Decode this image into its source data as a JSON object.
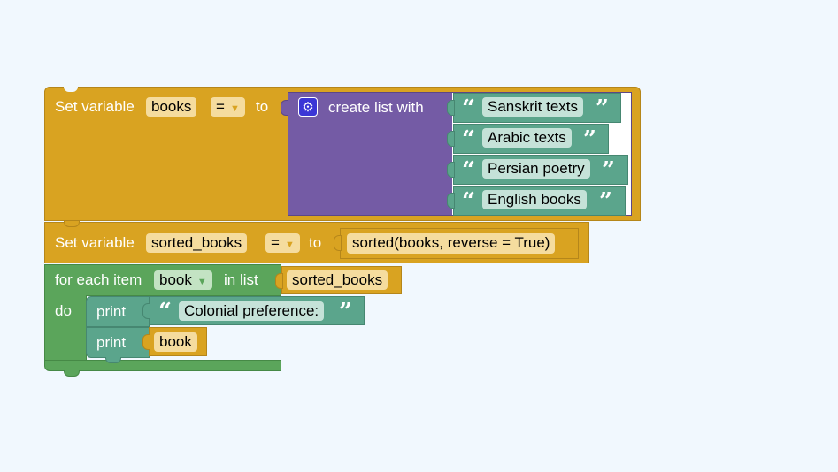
{
  "workspace": {
    "blocks": {
      "set_books": {
        "label_set": "Set variable",
        "variable": "books",
        "operator": "=",
        "label_to": "to"
      },
      "create_list": {
        "label": "create list with",
        "items": [
          "Sanskrit texts",
          "Arabic texts",
          "Persian poetry",
          "English books"
        ]
      },
      "set_sorted": {
        "label_set": "Set variable",
        "variable": "sorted_books",
        "operator": "=",
        "label_to": "to",
        "expression": "sorted(books, reverse = True)"
      },
      "for_each": {
        "label_for": "for each item",
        "variable": "book",
        "label_in": "in list",
        "list": "sorted_books",
        "label_do": "do"
      },
      "print_1": {
        "label": "print",
        "text": "Colonial preference:"
      },
      "print_2": {
        "label": "print",
        "variable": "book"
      }
    },
    "quote_open": "“",
    "quote_close": "”",
    "dropdown_arrow": "▼"
  },
  "colors": {
    "variables": "#d9a321",
    "lists": "#745ba5",
    "text": "#5ba58c",
    "loops": "#5ba55b",
    "background": "#f1f8fe"
  }
}
